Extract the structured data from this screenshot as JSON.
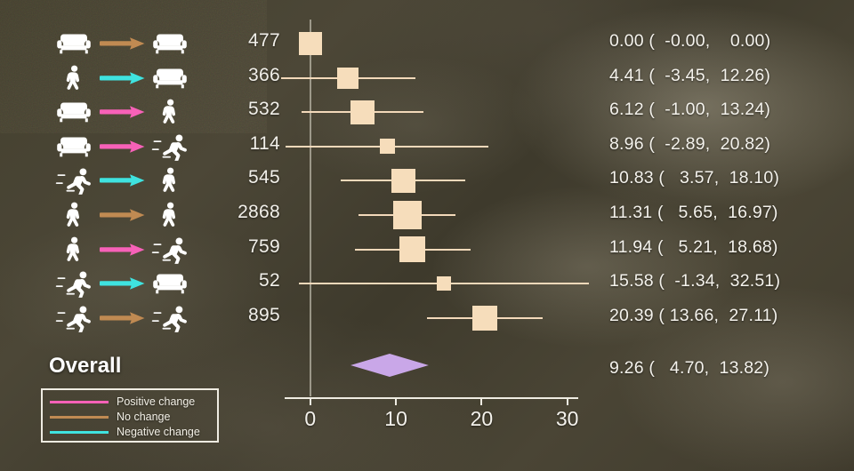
{
  "chart_data": {
    "type": "forest",
    "title": "",
    "xlabel": "",
    "ylabel": "",
    "xlim": [
      -3,
      33
    ],
    "x_ticks": [
      0,
      10,
      20,
      30
    ],
    "x_tick_labels": [
      "0",
      "10",
      "20",
      "30"
    ],
    "grid": false,
    "reference_line": 0,
    "legend_position": "bottom-left",
    "columns": [
      "transition",
      "n",
      "effect_ci"
    ],
    "rows": [
      {
        "from": "couch",
        "to": "couch",
        "arrow_color": "#c08a52",
        "arrow_type": "no-change",
        "n": "477",
        "estimate": 0.0,
        "ci_low": -0.0,
        "ci_high": 0.0,
        "stat_text": "0.00 (  -0.00,    0.00)",
        "marker_size": 26
      },
      {
        "from": "walk",
        "to": "couch",
        "arrow_color": "#3fe3e0",
        "arrow_type": "negative",
        "n": "366",
        "estimate": 4.41,
        "ci_low": -3.45,
        "ci_high": 12.26,
        "stat_text": "4.41 (  -3.45,  12.26)",
        "marker_size": 24
      },
      {
        "from": "couch",
        "to": "walk",
        "arrow_color": "#f761b8",
        "arrow_type": "positive",
        "n": "532",
        "estimate": 6.12,
        "ci_low": -1.0,
        "ci_high": 13.24,
        "stat_text": "6.12 (  -1.00,  13.24)",
        "marker_size": 27
      },
      {
        "from": "couch",
        "to": "run",
        "arrow_color": "#f761b8",
        "arrow_type": "positive",
        "n": "114",
        "estimate": 8.96,
        "ci_low": -2.89,
        "ci_high": 20.82,
        "stat_text": "8.96 (  -2.89,  20.82)",
        "marker_size": 17
      },
      {
        "from": "run",
        "to": "walk",
        "arrow_color": "#3fe3e0",
        "arrow_type": "negative",
        "n": "545",
        "estimate": 10.83,
        "ci_low": 3.57,
        "ci_high": 18.1,
        "stat_text": "10.83 (   3.57,  18.10)",
        "marker_size": 27
      },
      {
        "from": "walk",
        "to": "walk",
        "arrow_color": "#c08a52",
        "arrow_type": "no-change",
        "n": "2868",
        "estimate": 11.31,
        "ci_low": 5.65,
        "ci_high": 16.97,
        "stat_text": "11.31 (   5.65,  16.97)",
        "marker_size": 32
      },
      {
        "from": "walk",
        "to": "run",
        "arrow_color": "#f761b8",
        "arrow_type": "positive",
        "n": "759",
        "estimate": 11.94,
        "ci_low": 5.21,
        "ci_high": 18.68,
        "stat_text": "11.94 (   5.21,  18.68)",
        "marker_size": 29
      },
      {
        "from": "run",
        "to": "couch",
        "arrow_color": "#3fe3e0",
        "arrow_type": "negative",
        "n": "52",
        "estimate": 15.58,
        "ci_low": -1.34,
        "ci_high": 32.51,
        "stat_text": "15.58 (  -1.34,  32.51)",
        "marker_size": 16
      },
      {
        "from": "run",
        "to": "run",
        "arrow_color": "#c08a52",
        "arrow_type": "no-change",
        "n": "895",
        "estimate": 20.39,
        "ci_low": 13.66,
        "ci_high": 27.11,
        "stat_text": "20.39 ( 13.66,  27.11)",
        "marker_size": 28
      }
    ],
    "overall": {
      "label": "Overall",
      "estimate": 9.26,
      "ci_low": 4.7,
      "ci_high": 13.82,
      "stat_text": "9.26 (   4.70,  13.82)",
      "color": "#c9a7e8"
    },
    "marker_color": "#f6ddbb",
    "ci_color": "#f3d9ba"
  },
  "legend": {
    "items": [
      {
        "label": "Positive change",
        "color": "#f761b8"
      },
      {
        "label": "No change",
        "color": "#c08a52"
      },
      {
        "label": "Negative change",
        "color": "#3fe3e0"
      }
    ]
  }
}
